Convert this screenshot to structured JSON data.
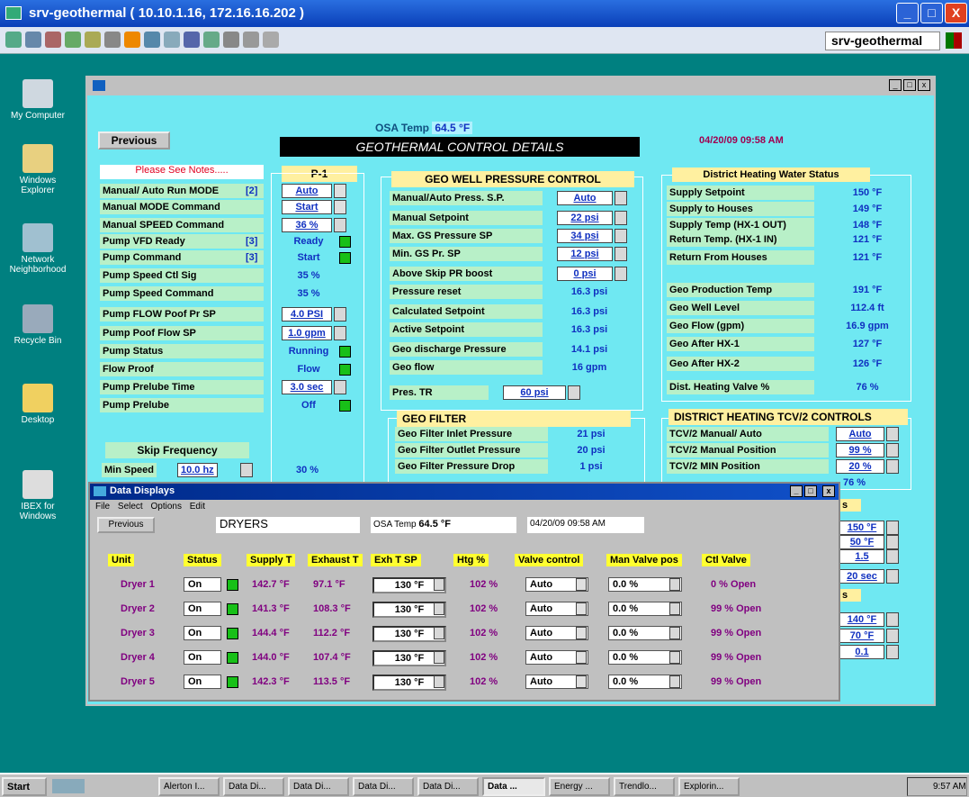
{
  "window": {
    "title": "srv-geothermal ( 10.10.1.16, 172.16.16.202 )",
    "host": "srv-geothermal"
  },
  "desktop": [
    "My Computer",
    "Windows Explorer",
    "Network Neighborhood",
    "Recycle Bin",
    "Desktop",
    "IBEX for Windows"
  ],
  "main": {
    "previous": "Previous",
    "osa_label": "OSA Temp",
    "osa_value": "64.5 °F",
    "title": "GEOTHERMAL CONTROL DETAILS",
    "datetime": "04/20/09 09:58 AM",
    "notes": "Please See Notes.....",
    "p1": {
      "header": "P-1",
      "rows": [
        {
          "label": "Manual/ Auto Run MODE",
          "tag": "[2]",
          "value": "Auto"
        },
        {
          "label": "Manual  MODE Command",
          "value": "Start"
        },
        {
          "label": "Manual  SPEED Command",
          "value": "36 %"
        },
        {
          "label": "Pump VFD Ready",
          "tag": "[3]",
          "value": "Ready"
        },
        {
          "label": "Pump Command",
          "tag": "[3]",
          "value": "Start"
        },
        {
          "label": "Pump Speed Ctl Sig",
          "value": "35 %"
        },
        {
          "label": "Pump Speed Command",
          "value": "35 %"
        },
        {
          "label": "Pump FLOW Poof Pr SP",
          "value": "4.0 PSI"
        },
        {
          "label": "Pump Poof Flow SP",
          "value": "1.0 gpm"
        },
        {
          "label": "Pump  Status",
          "value": "Running"
        },
        {
          "label": "Flow Proof",
          "value": "Flow"
        },
        {
          "label": "Pump Prelube Time",
          "value": "3.0 sec"
        },
        {
          "label": "Pump  Prelube",
          "value": "Off"
        }
      ]
    },
    "skip": {
      "header": "Skip Frequency",
      "min_label": "Min Speed",
      "min_value": "10.0 hz",
      "pct": "30 %"
    },
    "geo_well": {
      "header": "GEO WELL PRESSURE CONTROL",
      "rows": [
        {
          "label": "Manual/Auto Press. S.P.",
          "value": "Auto"
        },
        {
          "label": "Manual Setpoint",
          "value": "22 psi"
        },
        {
          "label": "Max. GS Pressure SP",
          "value": "34 psi"
        },
        {
          "label": "Min. GS Pr. SP",
          "value": "12 psi"
        },
        {
          "label": "Above Skip PR boost",
          "value": "0 psi"
        },
        {
          "label": "Pressure reset",
          "value": "16.3 psi"
        },
        {
          "label": "Calculated Setpoint",
          "value": "16.3 psi"
        },
        {
          "label": "Active Setpoint",
          "value": "16.3 psi"
        },
        {
          "label": "Geo discharge Pressure",
          "value": "14.1 psi"
        },
        {
          "label": "Geo flow",
          "value": "16 gpm"
        }
      ],
      "pres_tr_label": "Pres. TR",
      "pres_tr_value": "60 psi"
    },
    "geo_filter": {
      "header": "GEO FILTER",
      "rows": [
        {
          "label": "Geo Filter Inlet Pressure",
          "value": "21 psi"
        },
        {
          "label": "Geo Filter Outlet Pressure",
          "value": "20 psi"
        },
        {
          "label": "Geo Filter Pressure Drop",
          "value": "1 psi"
        }
      ]
    },
    "district": {
      "header": "District Heating Water Status",
      "rows": [
        {
          "label": "Supply Setpoint",
          "value": "150 °F"
        },
        {
          "label": "Supply to Houses",
          "value": "149 °F"
        },
        {
          "label": "Supply Temp (HX-1 OUT)",
          "value": "148 °F"
        },
        {
          "label": "Return Temp.  (HX-1 IN)",
          "value": "121 °F"
        },
        {
          "label": "Return From Houses",
          "value": "121 °F"
        },
        {
          "label": "Geo Production Temp",
          "value": "191 °F"
        },
        {
          "label": "Geo Well Level",
          "value": "112.4 ft"
        },
        {
          "label": "Geo Flow (gpm)",
          "value": "16.9 gpm"
        },
        {
          "label": "Geo After HX-1",
          "value": "127 °F"
        },
        {
          "label": "Geo After HX-2",
          "value": "126 °F"
        },
        {
          "label": "Dist. Heating Valve %",
          "value": "76 %"
        }
      ]
    },
    "tcv": {
      "header": "DISTRICT HEATING TCV/2 CONTROLS",
      "rows": [
        {
          "label": "TCV/2 Manual/ Auto",
          "value": "Auto"
        },
        {
          "label": "TCV/2 Manual Position",
          "value": "99 %"
        },
        {
          "label": "TCV/2 MIN Position",
          "value": "20 %"
        }
      ],
      "extra": [
        "76 %",
        "s",
        "150 °F",
        "50 °F",
        "1.5",
        "20 sec",
        "s",
        "140 °F",
        "70 °F",
        "0.1"
      ]
    }
  },
  "dryers": {
    "title": "Data Displays",
    "menu": [
      "File",
      "Select",
      "Options",
      "Edit"
    ],
    "previous": "Previous",
    "name": "DRYERS",
    "osa_label": "OSA Temp",
    "osa_value": "64.5 °F",
    "datetime": "04/20/09 09:58 AM",
    "columns": [
      "Unit",
      "Status",
      "Supply T",
      "Exhaust T",
      "Exh T SP",
      "Htg %",
      "Valve control",
      "Man Valve pos",
      "Ctl Valve"
    ],
    "rows": [
      {
        "unit": "Dryer 1",
        "status": "On",
        "supply": "142.7 °F",
        "exhaust": "97.1 °F",
        "sp": "130 °F",
        "htg": "102 %",
        "valve": "Auto",
        "man": "0.0 %",
        "ctl": "0 % Open"
      },
      {
        "unit": "Dryer 2",
        "status": "On",
        "supply": "141.3 °F",
        "exhaust": "108.3 °F",
        "sp": "130 °F",
        "htg": "102 %",
        "valve": "Auto",
        "man": "0.0 %",
        "ctl": "99 % Open"
      },
      {
        "unit": "Dryer 3",
        "status": "On",
        "supply": "144.4 °F",
        "exhaust": "112.2 °F",
        "sp": "130 °F",
        "htg": "102 %",
        "valve": "Auto",
        "man": "0.0 %",
        "ctl": "99 % Open"
      },
      {
        "unit": "Dryer 4",
        "status": "On",
        "supply": "144.0 °F",
        "exhaust": "107.4 °F",
        "sp": "130 °F",
        "htg": "102 %",
        "valve": "Auto",
        "man": "0.0 %",
        "ctl": "99 % Open"
      },
      {
        "unit": "Dryer 5",
        "status": "On",
        "supply": "142.3 °F",
        "exhaust": "113.5 °F",
        "sp": "130 °F",
        "htg": "102 %",
        "valve": "Auto",
        "man": "0.0 %",
        "ctl": "99 % Open"
      }
    ]
  },
  "taskbar": {
    "start": "Start",
    "tasks": [
      "Alerton I...",
      "Data Di...",
      "Data Di...",
      "Data Di...",
      "Data Di...",
      "Data ...",
      "Energy ...",
      "Trendlo...",
      "Explorin..."
    ],
    "clock": "9:57 AM"
  }
}
